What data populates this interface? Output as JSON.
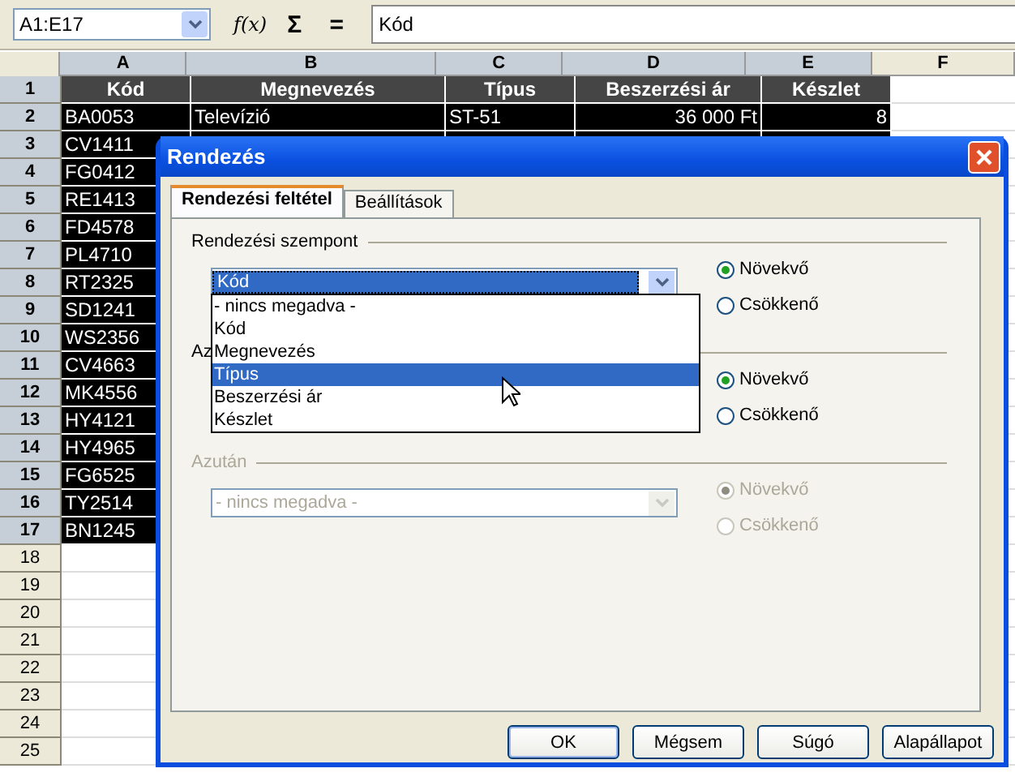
{
  "toolbar": {
    "name_box": "A1:E17",
    "function_label": "f(x)",
    "sum_symbol": "Σ",
    "equals_symbol": "=",
    "formula": "Kód"
  },
  "sheet": {
    "columns": [
      {
        "label": "A",
        "selected": true
      },
      {
        "label": "B",
        "selected": true
      },
      {
        "label": "C",
        "selected": true
      },
      {
        "label": "D",
        "selected": true
      },
      {
        "label": "E",
        "selected": true
      },
      {
        "label": "F",
        "selected": false
      }
    ],
    "rows": [
      {
        "number": "1",
        "selected": true,
        "cells": [
          {
            "text": "Kód",
            "kind": "header"
          },
          {
            "text": "Megnevezés",
            "kind": "header"
          },
          {
            "text": "Típus",
            "kind": "header"
          },
          {
            "text": "Beszerzési ár",
            "kind": "header"
          },
          {
            "text": "Készlet",
            "kind": "header"
          }
        ]
      },
      {
        "number": "2",
        "selected": true,
        "cells": [
          {
            "text": "BA0053",
            "kind": "text"
          },
          {
            "text": "Televízió",
            "kind": "text"
          },
          {
            "text": "ST-51",
            "kind": "text"
          },
          {
            "text": "36 000 Ft",
            "kind": "number"
          },
          {
            "text": "8",
            "kind": "number"
          }
        ]
      },
      {
        "number": "3",
        "selected": true,
        "cells": [
          {
            "text": "CV1411",
            "kind": "text"
          }
        ]
      },
      {
        "number": "4",
        "selected": true,
        "cells": [
          {
            "text": "FG0412",
            "kind": "text"
          }
        ]
      },
      {
        "number": "5",
        "selected": true,
        "cells": [
          {
            "text": "RE1413",
            "kind": "text"
          }
        ]
      },
      {
        "number": "6",
        "selected": true,
        "cells": [
          {
            "text": "FD4578",
            "kind": "text"
          }
        ]
      },
      {
        "number": "7",
        "selected": true,
        "cells": [
          {
            "text": "PL4710",
            "kind": "text"
          }
        ]
      },
      {
        "number": "8",
        "selected": true,
        "cells": [
          {
            "text": "RT2325",
            "kind": "text"
          }
        ]
      },
      {
        "number": "9",
        "selected": true,
        "cells": [
          {
            "text": "SD1241",
            "kind": "text"
          }
        ]
      },
      {
        "number": "10",
        "selected": true,
        "cells": [
          {
            "text": "WS2356",
            "kind": "text"
          }
        ]
      },
      {
        "number": "11",
        "selected": true,
        "cells": [
          {
            "text": "CV4663",
            "kind": "text"
          }
        ]
      },
      {
        "number": "12",
        "selected": true,
        "cells": [
          {
            "text": "MK4556",
            "kind": "text"
          }
        ]
      },
      {
        "number": "13",
        "selected": true,
        "cells": [
          {
            "text": "HY4121",
            "kind": "text"
          }
        ]
      },
      {
        "number": "14",
        "selected": true,
        "cells": [
          {
            "text": "HY4965",
            "kind": "text"
          }
        ]
      },
      {
        "number": "15",
        "selected": true,
        "cells": [
          {
            "text": "FG6525",
            "kind": "text"
          }
        ]
      },
      {
        "number": "16",
        "selected": true,
        "cells": [
          {
            "text": "TY2514",
            "kind": "text"
          }
        ]
      },
      {
        "number": "17",
        "selected": true,
        "cells": [
          {
            "text": "BN1245",
            "kind": "text"
          }
        ]
      },
      {
        "number": "18",
        "selected": false,
        "cells": []
      },
      {
        "number": "19",
        "selected": false,
        "cells": []
      },
      {
        "number": "20",
        "selected": false,
        "cells": []
      },
      {
        "number": "21",
        "selected": false,
        "cells": []
      },
      {
        "number": "22",
        "selected": false,
        "cells": []
      },
      {
        "number": "23",
        "selected": false,
        "cells": []
      },
      {
        "number": "24",
        "selected": false,
        "cells": []
      },
      {
        "number": "25",
        "selected": false,
        "cells": []
      }
    ]
  },
  "dialog": {
    "title": "Rendezés",
    "tabs": [
      {
        "label": "Rendezési feltétel",
        "selected": true
      },
      {
        "label": "Beállítások",
        "selected": false
      }
    ],
    "sections": [
      {
        "label": "Rendezési szempont",
        "disabled": false,
        "combo": {
          "value": "Kód",
          "expanded": true,
          "options": [
            {
              "label": "- nincs megadva -",
              "highlighted": false
            },
            {
              "label": "Kód",
              "highlighted": false
            },
            {
              "label": "Megnevezés",
              "highlighted": false
            },
            {
              "label": "Típus",
              "highlighted": true
            },
            {
              "label": "Beszerzési ár",
              "highlighted": false
            },
            {
              "label": "Készlet",
              "highlighted": false
            }
          ]
        },
        "radios": [
          {
            "label": "Növekvő",
            "selected": true
          },
          {
            "label": "Csökkenő",
            "selected": false
          }
        ]
      },
      {
        "label": "Az",
        "disabled": false,
        "radios": [
          {
            "label": "Növekvő",
            "selected": true
          },
          {
            "label": "Csökkenő",
            "selected": false
          }
        ]
      },
      {
        "label": "Azután",
        "disabled": true,
        "combo": {
          "value": "- nincs megadva -",
          "expanded": false
        },
        "radios": [
          {
            "label": "Növekvő",
            "selected": true
          },
          {
            "label": "Csökkenő",
            "selected": false
          }
        ]
      }
    ],
    "buttons": [
      {
        "label": "OK",
        "default": true
      },
      {
        "label": "Mégsem",
        "default": false
      },
      {
        "label": "Súgó",
        "default": false
      },
      {
        "label": "Alapállapot",
        "default": false
      }
    ]
  }
}
